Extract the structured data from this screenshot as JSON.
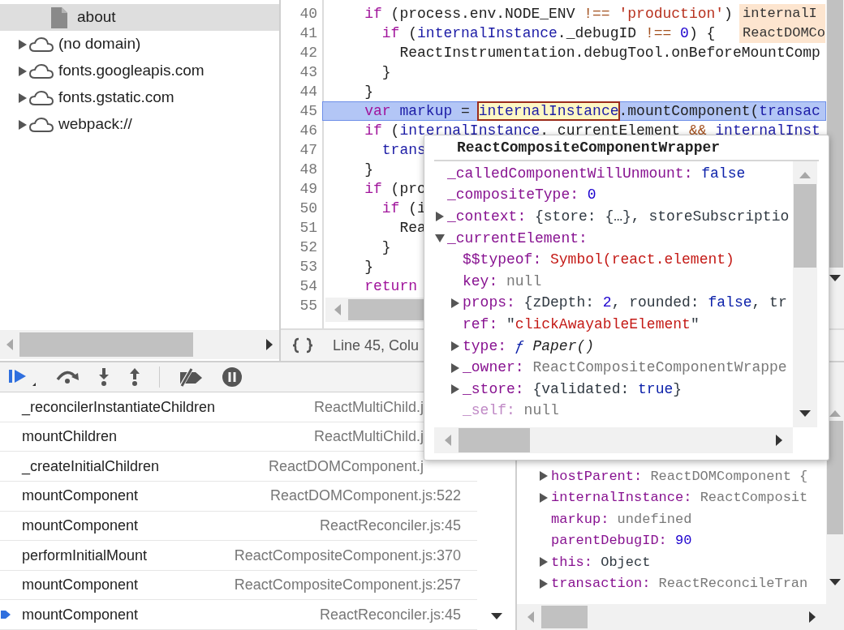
{
  "file_tree": {
    "items": [
      {
        "label": "about",
        "kind": "file",
        "selected": true
      },
      {
        "label": "(no domain)",
        "kind": "domain",
        "selected": false,
        "expanded": false
      },
      {
        "label": "fonts.googleapis.com",
        "kind": "domain",
        "selected": false,
        "expanded": false
      },
      {
        "label": "fonts.gstatic.com",
        "kind": "domain",
        "selected": false,
        "expanded": false
      },
      {
        "label": "webpack://",
        "kind": "domain",
        "selected": false,
        "expanded": false
      }
    ]
  },
  "editor": {
    "lines": [
      {
        "number": "40",
        "current": false,
        "tokens": [
          {
            "text": "    if",
            "kind": "keyword"
          },
          {
            "text": " (process.env.NODE_ENV ",
            "kind": "plain"
          },
          {
            "text": "!==",
            "kind": "operator"
          },
          {
            "text": " 'production'",
            "kind": "string"
          },
          {
            "text": ")",
            "kind": "plain"
          }
        ]
      },
      {
        "number": "41",
        "current": false,
        "tokens": [
          {
            "text": "      if",
            "kind": "keyword"
          },
          {
            "text": " (",
            "kind": "plain"
          },
          {
            "text": "internalInstance",
            "kind": "variable"
          },
          {
            "text": "._debugID ",
            "kind": "plain"
          },
          {
            "text": "!==",
            "kind": "operator"
          },
          {
            "text": " 0",
            "kind": "number"
          },
          {
            "text": ") {",
            "kind": "plain"
          }
        ]
      },
      {
        "number": "42",
        "current": false,
        "tokens": [
          {
            "text": "        ReactInstrumentation.debugTool.onBeforeMountComp",
            "kind": "plain"
          }
        ]
      },
      {
        "number": "43",
        "current": false,
        "tokens": [
          {
            "text": "      }",
            "kind": "plain"
          }
        ]
      },
      {
        "number": "44",
        "current": false,
        "tokens": [
          {
            "text": "    }",
            "kind": "plain"
          }
        ]
      },
      {
        "number": "45",
        "current": true,
        "tokens": [
          {
            "text": "    var",
            "kind": "keyword"
          },
          {
            "text": " markup",
            "kind": "variable"
          },
          {
            "text": " = ",
            "kind": "plain"
          },
          {
            "text": "internalInstance",
            "kind": "hover"
          },
          {
            "text": ".mountComponent(",
            "kind": "plain"
          },
          {
            "text": "transac",
            "kind": "variable"
          }
        ]
      },
      {
        "number": "46",
        "current": false,
        "tokens": [
          {
            "text": "    if",
            "kind": "keyword"
          },
          {
            "text": " (",
            "kind": "plain"
          },
          {
            "text": "internalInstance",
            "kind": "variable"
          },
          {
            "text": "._currentElement ",
            "kind": "plain"
          },
          {
            "text": "&&",
            "kind": "operator"
          },
          {
            "text": " internalInst",
            "kind": "variable"
          }
        ]
      },
      {
        "number": "47",
        "current": false,
        "tokens": [
          {
            "text": "      trans",
            "kind": "variable"
          }
        ]
      },
      {
        "number": "48",
        "current": false,
        "tokens": [
          {
            "text": "    }",
            "kind": "plain"
          }
        ]
      },
      {
        "number": "49",
        "current": false,
        "tokens": [
          {
            "text": "    if",
            "kind": "keyword"
          },
          {
            "text": " (pro",
            "kind": "plain"
          }
        ]
      },
      {
        "number": "50",
        "current": false,
        "tokens": [
          {
            "text": "      if",
            "kind": "keyword"
          },
          {
            "text": " (i",
            "kind": "plain"
          }
        ]
      },
      {
        "number": "51",
        "current": false,
        "tokens": [
          {
            "text": "        Rea",
            "kind": "plain"
          }
        ]
      },
      {
        "number": "52",
        "current": false,
        "tokens": [
          {
            "text": "      }",
            "kind": "plain"
          }
        ]
      },
      {
        "number": "53",
        "current": false,
        "tokens": [
          {
            "text": "    }",
            "kind": "plain"
          }
        ]
      },
      {
        "number": "54",
        "current": false,
        "tokens": [
          {
            "text": "    return",
            "kind": "keyword"
          }
        ]
      },
      {
        "number": "55",
        "current": false
      }
    ],
    "inline_values": [
      "internalI",
      "ReactDOMCo"
    ]
  },
  "status_bar": {
    "position": "Line 45, Colu"
  },
  "call_stack": {
    "frames": [
      {
        "function": "_reconcilerInstantiateChildren",
        "location": "ReactMultiChild.j",
        "current": false,
        "cut_off": true
      },
      {
        "function": "mountChildren",
        "location": "ReactMultiChild.j",
        "current": false,
        "cut_off": true
      },
      {
        "function": "_createInitialChildren",
        "location": "ReactDOMComponent.j",
        "current": false,
        "cut_off": true
      },
      {
        "function": "mountComponent",
        "location": "ReactDOMComponent.js:522",
        "current": false,
        "cut_off": false
      },
      {
        "function": "mountComponent",
        "location": "ReactReconciler.js:45",
        "current": false,
        "cut_off": false
      },
      {
        "function": "performInitialMount",
        "location": "ReactCompositeComponent.js:370",
        "current": false,
        "cut_off": false
      },
      {
        "function": "mountComponent",
        "location": "ReactCompositeComponent.js:257",
        "current": false,
        "cut_off": false
      },
      {
        "function": "mountComponent",
        "location": "ReactReconciler.js:45",
        "current": true,
        "cut_off": false
      }
    ]
  },
  "scope": {
    "items": [
      {
        "key": "hostParent:",
        "kind": "object",
        "expanded": false,
        "value": [
          {
            "text": "ReactDOMComponent {",
            "kind": "gray"
          }
        ]
      },
      {
        "key": "internalInstance:",
        "kind": "object",
        "expanded": false,
        "value": [
          {
            "text": "ReactComposit",
            "kind": "gray"
          }
        ]
      },
      {
        "key": "markup:",
        "kind": "value",
        "value": [
          {
            "text": "undefined",
            "kind": "gray"
          }
        ]
      },
      {
        "key": "parentDebugID:",
        "kind": "value",
        "value": [
          {
            "text": "90",
            "kind": "number"
          }
        ]
      },
      {
        "key": "this:",
        "kind": "object",
        "expanded": false,
        "value": [
          {
            "text": "Object",
            "kind": "plain"
          }
        ]
      },
      {
        "key": "transaction:",
        "kind": "object",
        "expanded": false,
        "value": [
          {
            "text": "ReactReconcileTran",
            "kind": "gray"
          }
        ]
      }
    ]
  },
  "popover": {
    "title": "ReactCompositeComponentWrapper",
    "items": [
      {
        "key": "_calledComponentWillUnmount:",
        "kind": "value",
        "faded": false,
        "value": [
          {
            "text": "false",
            "kind": "bool"
          }
        ]
      },
      {
        "key": "_compositeType:",
        "kind": "value",
        "faded": false,
        "value": [
          {
            "text": "0",
            "kind": "number"
          }
        ]
      },
      {
        "key": "_context:",
        "kind": "object",
        "expanded": false,
        "faded": false,
        "value": [
          {
            "text": "{store: {…}, storeSubscriptio",
            "kind": "plain"
          }
        ]
      },
      {
        "key": "_currentElement:",
        "kind": "object",
        "expanded": true,
        "faded": false,
        "children": [
          {
            "key": "$$typeof:",
            "kind": "value",
            "faded": false,
            "value": [
              {
                "text": "Symbol(react.element)",
                "kind": "string"
              }
            ]
          },
          {
            "key": "key:",
            "kind": "value",
            "faded": false,
            "value": [
              {
                "text": "null",
                "kind": "gray"
              }
            ]
          },
          {
            "key": "props:",
            "kind": "object",
            "expanded": false,
            "faded": false,
            "value": [
              {
                "text": "{zDepth:",
                "kind": "plain"
              },
              {
                "text": " 2",
                "kind": "number"
              },
              {
                "text": ", rounded:",
                "kind": "plain"
              },
              {
                "text": " false",
                "kind": "bool"
              },
              {
                "text": ", tr",
                "kind": "plain"
              }
            ]
          },
          {
            "key": "ref:",
            "kind": "value",
            "faded": false,
            "value": [
              {
                "text": "\"",
                "kind": "plain"
              },
              {
                "text": "clickAwayableElement",
                "kind": "string"
              },
              {
                "text": "\"",
                "kind": "plain"
              }
            ]
          },
          {
            "key": "type:",
            "kind": "object",
            "expanded": false,
            "faded": false,
            "value": [
              {
                "text": "ƒ",
                "kind": "func"
              },
              {
                "text": " Paper()",
                "kind": "italic"
              }
            ]
          },
          {
            "key": "_owner:",
            "kind": "object",
            "expanded": false,
            "faded": false,
            "value": [
              {
                "text": "ReactCompositeComponentWrappe",
                "kind": "gray"
              }
            ]
          },
          {
            "key": "_store:",
            "kind": "object",
            "expanded": false,
            "faded": false,
            "value": [
              {
                "text": "{validated:",
                "kind": "plain"
              },
              {
                "text": " true",
                "kind": "bool"
              },
              {
                "text": "}",
                "kind": "plain"
              }
            ]
          },
          {
            "key": "_self:",
            "kind": "value",
            "faded": true,
            "value": [
              {
                "text": "null",
                "kind": "gray"
              }
            ]
          }
        ]
      }
    ]
  }
}
